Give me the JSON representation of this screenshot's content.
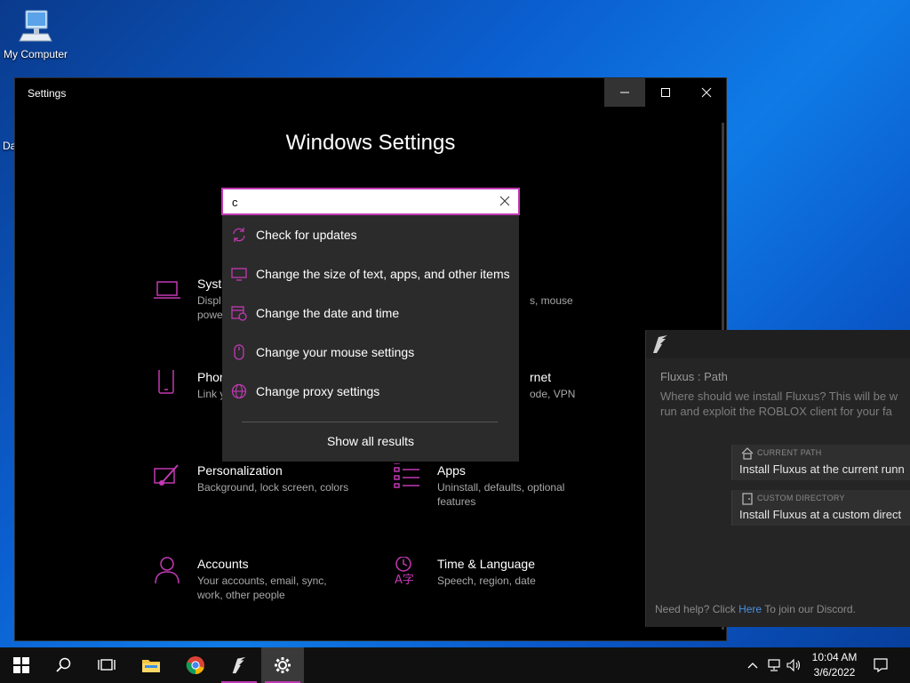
{
  "desktop": {
    "icon_label": "My Computer",
    "partial_icon_label": "Da"
  },
  "settings": {
    "window_title": "Settings",
    "heading": "Windows Settings",
    "tiles": [
      {
        "title": "Syste",
        "desc": "Displ\npowe",
        "icon": "laptop-icon"
      },
      {
        "title": "Phor",
        "desc": "Link y",
        "icon": "phone-icon"
      },
      {
        "title": "Personalization",
        "desc": "Background, lock screen, colors",
        "icon": "paintbrush-icon"
      },
      {
        "title": "Accounts",
        "desc": "Your accounts, email, sync, work, other people",
        "icon": "person-icon"
      },
      {
        "title": "",
        "desc": "s, mouse",
        "icon": ""
      },
      {
        "title": "rnet",
        "desc": "ode, VPN",
        "icon": ""
      },
      {
        "title": "Apps",
        "desc": "Uninstall, defaults, optional features",
        "icon": "apps-list-icon"
      },
      {
        "title": "Time & Language",
        "desc": "Speech, region, date",
        "icon": "time-language-icon"
      }
    ]
  },
  "search": {
    "value": "c",
    "results": [
      {
        "label": "Check for updates",
        "icon": "sync-icon"
      },
      {
        "label": "Change the size of text, apps, and other items",
        "icon": "display-icon"
      },
      {
        "label": "Change the date and time",
        "icon": "calendar-clock-icon"
      },
      {
        "label": "Change your mouse settings",
        "icon": "mouse-icon"
      },
      {
        "label": "Change proxy settings",
        "icon": "globe-icon"
      }
    ],
    "show_all": "Show all results"
  },
  "fluxus": {
    "title": "Fluxus : Path",
    "desc_line1": "Where should we install Fluxus? This will be w",
    "desc_line2": "run and exploit the ROBLOX client for your fa",
    "options": [
      {
        "small": "CURRENT PATH",
        "main": "Install Fluxus at the current runn",
        "icon": "home-icon"
      },
      {
        "small": "CUSTOM DIRECTORY",
        "main": "Install Fluxus at a custom direct",
        "icon": "door-icon"
      }
    ],
    "help_prefix": "Need help? Click",
    "help_link": "Here",
    "help_suffix": "To join our Discord."
  },
  "taskbar": {
    "time": "10:04 AM",
    "date": "3/6/2022"
  },
  "colors": {
    "accent": "#c239b3",
    "window_bg": "#000000",
    "dropdown_bg": "#2b2b2b",
    "fluxus_bg": "#252526",
    "link": "#4b8fe0"
  }
}
